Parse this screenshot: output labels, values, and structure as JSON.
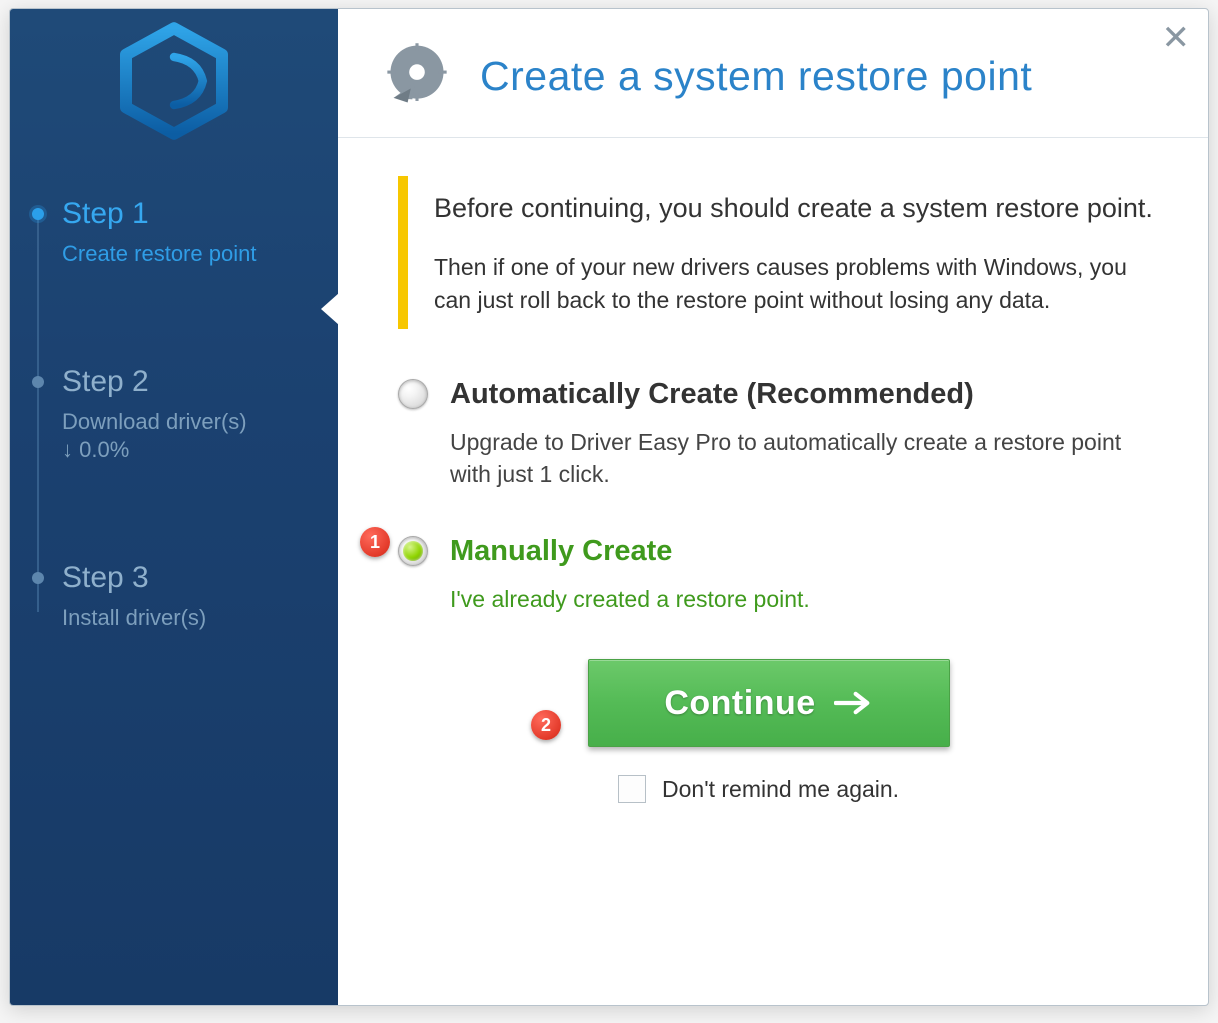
{
  "sidebar": {
    "steps": [
      {
        "title": "Step 1",
        "subtitle": "Create restore point",
        "active": true
      },
      {
        "title": "Step 2",
        "subtitle": "Download driver(s)\n↓ 0.0%",
        "active": false
      },
      {
        "title": "Step 3",
        "subtitle": "Install driver(s)",
        "active": false
      }
    ]
  },
  "header": {
    "title": "Create a system restore point"
  },
  "intro": {
    "p1": "Before continuing, you should create a system restore point.",
    "p2": "Then if one of your new drivers causes problems with Windows, you can just roll back to the restore point without losing any data."
  },
  "options": {
    "auto": {
      "label": "Automatically Create (Recommended)",
      "desc": "Upgrade to Driver Easy Pro to automatically create a restore point with just 1 click."
    },
    "manual": {
      "label": "Manually Create",
      "desc": "I've already created a restore point."
    }
  },
  "markers": {
    "one": "1",
    "two": "2"
  },
  "action": {
    "continue_label": "Continue",
    "remind_label": "Don't remind me again."
  }
}
